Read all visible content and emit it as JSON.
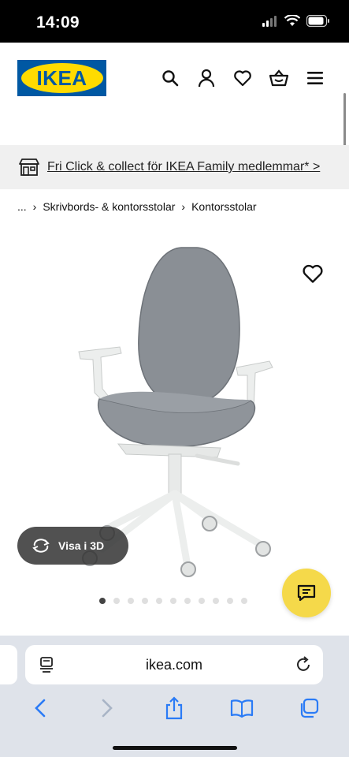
{
  "status_bar": {
    "time": "14:09",
    "icons": [
      "signal-icon",
      "wifi-icon",
      "battery-icon"
    ]
  },
  "header": {
    "logo_text": "IKEA",
    "icons": [
      "search-icon",
      "profile-icon",
      "heart-icon",
      "basket-icon",
      "menu-icon"
    ]
  },
  "promo": {
    "text": "Fri Click & collect för IKEA Family medlemmar* >"
  },
  "breadcrumb": {
    "items": [
      "...",
      "Skrivbords- & kontorsstolar",
      "Kontorsstolar"
    ]
  },
  "product": {
    "view_3d_label": "Visa i 3D",
    "carousel": {
      "total": 11,
      "active_index": 0
    }
  },
  "browser": {
    "url": "ikea.com"
  },
  "colors": {
    "ikea_blue": "#0058a3",
    "ikea_yellow": "#ffdb00",
    "chat_yellow": "#f5d94a",
    "chair_fabric": "#8a8f95"
  }
}
